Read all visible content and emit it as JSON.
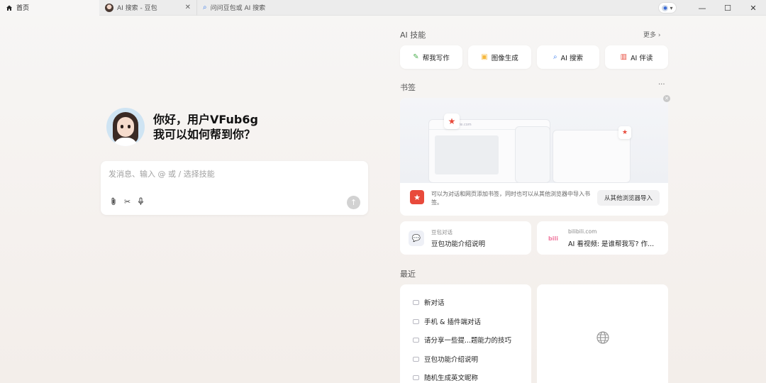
{
  "tabs": {
    "home": {
      "label": "首页",
      "icon": "home-icon"
    },
    "search": {
      "label": "AI 搜索 - 豆包",
      "icon": "doubao-avatar-icon"
    },
    "ask": {
      "label": "问问豆包或 AI 搜索",
      "icon": "ai-search-icon"
    }
  },
  "greeting": {
    "line1": "你好，用户VFub6g",
    "line2": "我可以如何帮到你？"
  },
  "composer": {
    "placeholder": "发消息、输入 @ 或 / 选择技能"
  },
  "skills": {
    "title": "AI 技能",
    "more": "更多 ›",
    "items": [
      {
        "label": "帮我写作",
        "icon": "pen-icon",
        "color": "#4caf50"
      },
      {
        "label": "图像生成",
        "icon": "image-icon",
        "color": "#f5b83d"
      },
      {
        "label": "AI 搜索",
        "icon": "search-icon",
        "color": "#3b7ded"
      },
      {
        "label": "AI 伴读",
        "icon": "book-icon",
        "color": "#e84a3b"
      }
    ]
  },
  "bookmarks": {
    "title": "书签",
    "more": "···",
    "illus_url": "website.com",
    "desc": "可以为对话和网页添加书签，同时也可以从其他浏览器中导入书签。",
    "import_label": "从其他浏览器导入",
    "cards": [
      {
        "source": "豆包对话",
        "title": "豆包功能介绍说明",
        "icon": "chat-icon"
      },
      {
        "source": "bilibili.com",
        "title": "AI 看视频: 是谁帮我写? 作...",
        "icon": "bilibili-icon"
      }
    ]
  },
  "recent": {
    "title": "最近",
    "items": [
      "新对话",
      "手机 & 插件端对话",
      "请分享一些提...题能力的技巧",
      "豆包功能介绍说明",
      "随机生成英文昵称"
    ]
  },
  "colors": {
    "accent_red": "#e84a3b",
    "background": "#f6f3f1"
  }
}
